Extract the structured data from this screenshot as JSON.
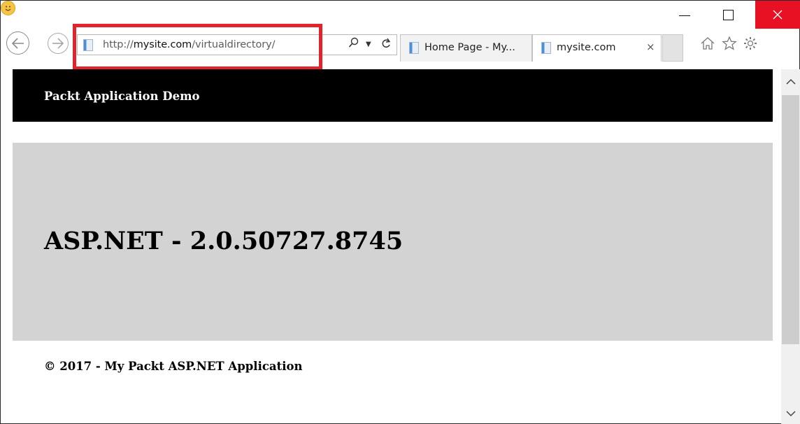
{
  "browser": {
    "address": {
      "scheme": "http://",
      "host": "mysite.com",
      "path": "/virtualdirectory/"
    },
    "tabs": [
      {
        "label": "Home Page - My...",
        "active": false
      },
      {
        "label": "mysite.com",
        "active": true,
        "close": "×"
      }
    ],
    "icons": [
      "back-icon",
      "forward-icon",
      "search-icon",
      "refresh-icon",
      "home-icon",
      "favorites-star-icon",
      "gear-icon",
      "smiley-icon"
    ],
    "highlight_color": "#e3222a",
    "close_button_color": "#e81123"
  },
  "page": {
    "header_title": "Packt Application Demo",
    "heading": "ASP.NET - 2.0.50727.8745",
    "footer": "© 2017 - My Packt ASP.NET Application",
    "colors": {
      "header_bg": "#000000",
      "hero_bg": "#d3d3d3"
    }
  }
}
